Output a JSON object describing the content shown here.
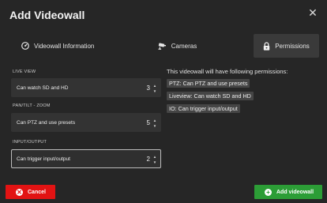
{
  "dialog": {
    "title": "Add Videowall",
    "close_glyph": "✕"
  },
  "tabs": [
    {
      "label": "Videowall Information",
      "icon": "dashboard-icon"
    },
    {
      "label": "Cameras",
      "icon": "camera-icon"
    },
    {
      "label": "Permissions",
      "icon": "lock-icon",
      "selected": true
    }
  ],
  "sections": {
    "live_view": {
      "label": "LIVE VIEW",
      "value_label": "Can watch SD and HD",
      "level": "3"
    },
    "pan_tilt_zoom": {
      "label": "PAN/TILT - ZOOM",
      "value_label": "Can PTZ and use presets",
      "level": "5"
    },
    "input_output": {
      "label": "INPUT/OUTPUT",
      "value_label": "Can trigger input/output",
      "level": "2"
    }
  },
  "permissions": {
    "heading": "This videowall will have following permissions:",
    "items": [
      "PTZ: Can PTZ and use presets",
      "Liveview: Can watch SD and HD",
      "IO: Can trigger input/output"
    ]
  },
  "buttons": {
    "cancel": "Cancel",
    "cancel_glyph": "✕",
    "add": "Add videowall",
    "add_glyph": "+"
  },
  "colors": {
    "background": "#262626",
    "cancel": "#e21313",
    "add": "#2c9d36",
    "selected_tab": "#3a3a3a"
  }
}
